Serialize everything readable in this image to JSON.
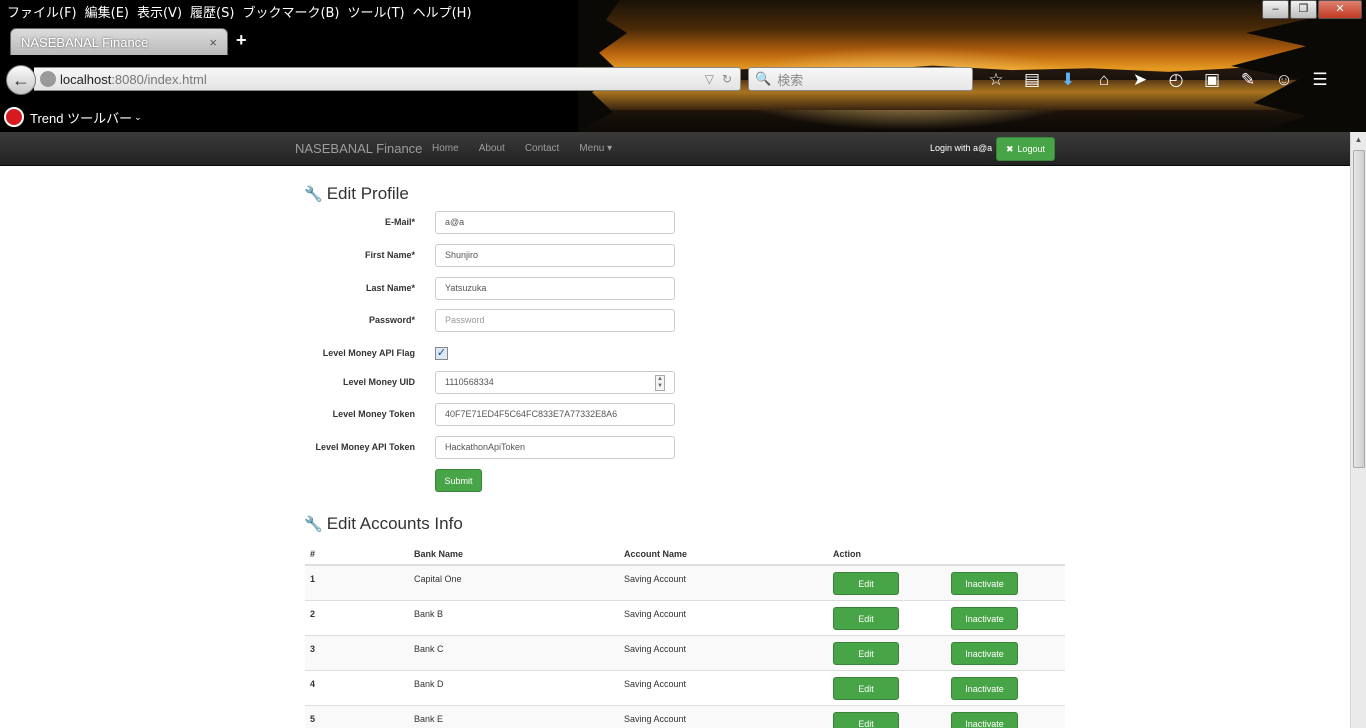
{
  "browser": {
    "menu": [
      "ファイル(F)",
      "編集(E)",
      "表示(V)",
      "履歴(S)",
      "ブックマーク(B)",
      "ツール(T)",
      "ヘルプ(H)"
    ],
    "tab_title": "NASEBANAL Finance",
    "tab_close": "×",
    "new_tab": "+",
    "url_host": "localhost",
    "url_rest": ":8080/index.html",
    "search_placeholder": "検索",
    "trend_toolbar": "Trend ツールバー",
    "window_controls": {
      "minimize": "–",
      "maximize": "❐",
      "close": "✕"
    },
    "toolbar_icons": [
      "star-icon",
      "reading-list-icon",
      "download-icon",
      "home-icon",
      "send-icon",
      "clock-icon",
      "selenium-icon",
      "extension-icon",
      "smiley-icon",
      "hamburger-menu-icon"
    ]
  },
  "navbar": {
    "brand": "NASEBANAL Finance",
    "links": [
      "Home",
      "About",
      "Contact",
      "Menu ▾"
    ],
    "login_text": "Login with a@a",
    "logout_label": "Logout"
  },
  "profile": {
    "heading": "Edit Profile",
    "fields": {
      "email": {
        "label": "E-Mail*",
        "value": "a@a"
      },
      "first_name": {
        "label": "First Name*",
        "value": "Shunjiro"
      },
      "last_name": {
        "label": "Last Name*",
        "value": "Yatsuzuka"
      },
      "password": {
        "label": "Password*",
        "placeholder": "Password"
      },
      "api_flag": {
        "label": "Level Money API Flag",
        "checked": true
      },
      "uid": {
        "label": "Level Money UID",
        "value": "1110568334"
      },
      "token": {
        "label": "Level Money Token",
        "value": "40F7E71ED4F5C64FC833E7A77332E8A6"
      },
      "api_token": {
        "label": "Level Money API Token",
        "value": "HackathonApiToken"
      }
    },
    "submit_label": "Submit"
  },
  "accounts": {
    "heading": "Edit Accounts Info",
    "columns": [
      "#",
      "Bank Name",
      "Account Name",
      "Action"
    ],
    "edit_label": "Edit",
    "inactivate_label": "Inactivate",
    "rows": [
      {
        "num": "1",
        "bank": "Capital One",
        "account": "Saving Account"
      },
      {
        "num": "2",
        "bank": "Bank B",
        "account": "Saving Account"
      },
      {
        "num": "3",
        "bank": "Bank C",
        "account": "Saving Account"
      },
      {
        "num": "4",
        "bank": "Bank D",
        "account": "Saving Account"
      },
      {
        "num": "5",
        "bank": "Bank E",
        "account": "Saving Account"
      }
    ]
  },
  "colors": {
    "success": "#47a447",
    "navbar": "#222222"
  }
}
